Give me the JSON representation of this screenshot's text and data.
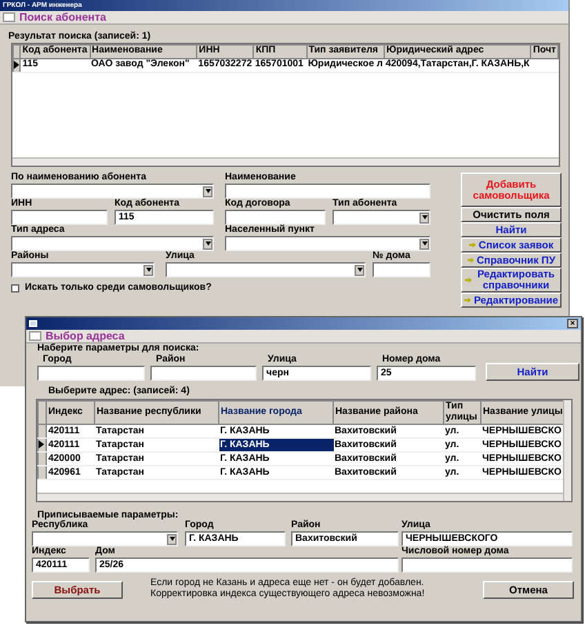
{
  "window": {
    "title": "ГРКОЛ - АРМ инженера"
  },
  "main": {
    "panel_title": "Поиск абонента",
    "results": {
      "title": "Результат поиска (записей: 1)",
      "columns": [
        "Код абонента",
        "Наименование",
        "ИНН",
        "КПП",
        "Тип заявителя",
        "Юридический адрес",
        "Почт"
      ],
      "rows": [
        {
          "selected": true,
          "cells": [
            "115",
            "ОАО завод \"Элекон\"",
            "1657032272",
            "165701001",
            "Юридическое л",
            "420094,Татарстан,Г. КАЗАНЬ,К",
            ""
          ]
        }
      ]
    },
    "form": [
      [
        {
          "label": "По наименованию абонента",
          "kind": "combo"
        },
        {
          "label": "Наименование",
          "kind": "text"
        }
      ],
      [
        {
          "label": "ИНН",
          "kind": "text"
        },
        {
          "label": "Код абонента",
          "kind": "text",
          "value": "115"
        },
        {
          "label": "Код договора",
          "kind": "text"
        },
        {
          "label": "Тип абонента",
          "kind": "combo"
        }
      ],
      [
        {
          "label": "Тип адреса",
          "kind": "combo"
        },
        {
          "label": "Населенный пункт",
          "kind": "combo"
        }
      ],
      [
        {
          "label": "Районы",
          "kind": "combo"
        },
        {
          "label": "Улица",
          "kind": "combo"
        },
        {
          "label": "№ дома",
          "kind": "text"
        }
      ]
    ],
    "checkbox": {
      "label": "Искать только среди самовольщиков?",
      "checked": false
    },
    "buttons": [
      {
        "label": "Добавить самовольщика",
        "kind": "red"
      },
      {
        "label": "Очистить поля",
        "kind": "plain"
      },
      {
        "label": "Найти",
        "kind": "blue"
      },
      {
        "label": "Список заявок",
        "kind": "arrow"
      },
      {
        "label": "Справочник ПУ",
        "kind": "arrow"
      },
      {
        "label": "Редактировать справочники",
        "kind": "arrow"
      },
      {
        "label": "Редактирование",
        "kind": "arrow"
      }
    ]
  },
  "dialog": {
    "close_glyph": "×",
    "panel_title": "Выбор адреса",
    "search_prompt": "Наберите параметры для поиска:",
    "search_fields": [
      {
        "label": "Город"
      },
      {
        "label": "Район"
      },
      {
        "label": "Улица",
        "value": "черн"
      },
      {
        "label": "Номер дома",
        "value": "25"
      }
    ],
    "find_button": "Найти",
    "table": {
      "title": "Выберите адрес: (записей: 4)",
      "columns": [
        {
          "label": "Индекс",
          "focused": false
        },
        {
          "label": "Название республики",
          "focused": false
        },
        {
          "label": "Название города",
          "focused": true
        },
        {
          "label": "Название района",
          "focused": false
        },
        {
          "label": "Тип улицы",
          "focused": false
        },
        {
          "label": "Название улицы",
          "focused": false
        }
      ],
      "rows": [
        {
          "selected": false,
          "cells": [
            "420111",
            "Татарстан",
            "Г. КАЗАНЬ",
            "Вахитовский",
            "ул.",
            "ЧЕРНЫШЕВСКО"
          ]
        },
        {
          "selected": true,
          "cells": [
            "420111",
            "Татарстан",
            "Г. КАЗАНЬ",
            "Вахитовский",
            "ул.",
            "ЧЕРНЫШЕВСКО"
          ]
        },
        {
          "selected": false,
          "cells": [
            "420000",
            "Татарстан",
            "Г. КАЗАНЬ",
            "Вахитовский",
            "ул.",
            "ЧЕРНЫШЕВСКО"
          ]
        },
        {
          "selected": false,
          "cells": [
            "420961",
            "Татарстан",
            "Г. КАЗАНЬ",
            "Вахитовский",
            "ул.",
            "ЧЕРНЫШЕВСКО"
          ]
        }
      ]
    },
    "assign_title": "Приписываемые параметры:",
    "assign_fields": [
      [
        {
          "label": "Республика",
          "kind": "combo"
        },
        {
          "label": "Город",
          "kind": "text",
          "value": "Г. КАЗАНЬ"
        },
        {
          "label": "Район",
          "kind": "text",
          "value": "Вахитовский"
        },
        {
          "label": "Улица",
          "kind": "text",
          "value": "ЧЕРНЫШЕВСКОГО"
        }
      ],
      [
        {
          "label": "Индекс",
          "kind": "text",
          "value": "420111"
        },
        {
          "label": "Дом",
          "kind": "text",
          "value": "25/26"
        },
        {
          "label": "Числовой номер дома",
          "kind": "text"
        }
      ]
    ],
    "ok_button": "Выбрать",
    "note": [
      "Если город не Казань и адреса еще нет - он будет добавлен.",
      "Корректировка индекса существующего адреса невозможна!"
    ],
    "cancel_button": "Отмена"
  }
}
